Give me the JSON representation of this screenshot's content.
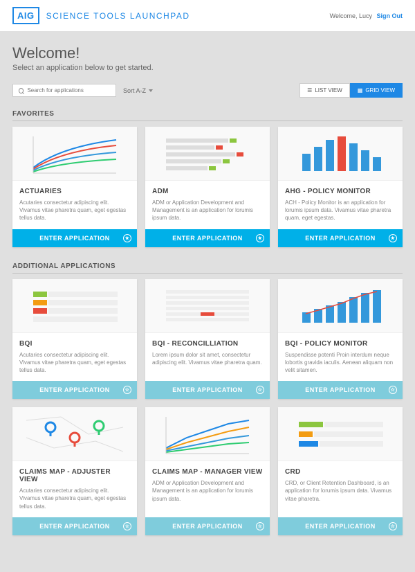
{
  "header": {
    "logo": "AIG",
    "brand": "SCIENCE TOOLS LAUNCHPAD",
    "welcome_user": "Welcome, Lucy",
    "signout": "Sign Out"
  },
  "welcome": {
    "title": "Welcome!",
    "subtitle": "Select an application below to get started."
  },
  "search": {
    "placeholder": "Search for applications"
  },
  "sort": {
    "label": "Sort A-Z"
  },
  "view": {
    "list": "LIST VIEW",
    "grid": "GRID VIEW"
  },
  "sections": {
    "favorites": "FAVORITES",
    "additional": "ADDITIONAL APPLICATIONS"
  },
  "enter_label": "ENTER APPLICATION",
  "favorites": [
    {
      "title": "ACTUARIES",
      "desc": "Acutaries consectetur adipiscing elit. Vivamus vitae pharetra quam, eget egestas tellus data."
    },
    {
      "title": "ADM",
      "desc": "ADM or Application Development and Management is an application for lorumis ipsum data."
    },
    {
      "title": "AHG - POLICY MONITOR",
      "desc": "ACH - Policy Monitor is an application for lorumis ipsum data. Vivamus vitae pharetra quam, eget egestas."
    }
  ],
  "additional": [
    {
      "title": "BQI",
      "desc": "Acutaries consectetur adipiscing elit. Vivamus vitae pharetra quam, eget egestas tellus data."
    },
    {
      "title": "BQI - RECONCILLIATION",
      "desc": "Lorem ipsum dolor sit amet, consectetur adipiscing elit. Vivamus vitae pharetra quam."
    },
    {
      "title": "BQI - POLICY MONITOR",
      "desc": "Suspendisse potenti Proin interdum neque lobortis gravida iaculis. Aenean aliquam non velit sitamen."
    },
    {
      "title": "CLAIMS MAP - ADJUSTER VIEW",
      "desc": "Acutaries consectetur adipiscing elit. Vivamus vitae pharetra quam, eget egestas tellus data."
    },
    {
      "title": "CLAIMS MAP - MANAGER VIEW",
      "desc": "ADM or Application Development and Management is an application for lorumis ipsum data."
    },
    {
      "title": "CRD",
      "desc": "CRD, or Client Retention Dashboard, is an application for lorumis ipsum data. Vivamus vitae pharetra."
    }
  ],
  "colors": {
    "accent": "#1e88e5",
    "cta": "#00b0e8",
    "red": "#e74c3c",
    "green": "#8cc63f",
    "orange": "#f39c12",
    "yellow": "#f1c40f"
  }
}
